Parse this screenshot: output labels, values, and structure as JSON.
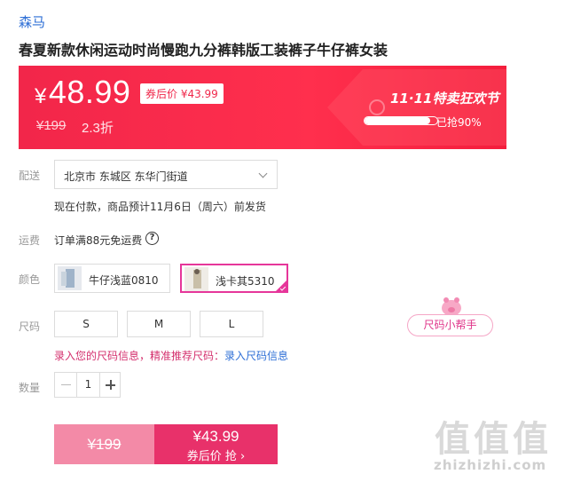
{
  "product": {
    "brand": "森马",
    "title": "春夏新款休闲运动时尚慢跑九分裤韩版工装裤子牛仔裤女装"
  },
  "price_banner": {
    "currency": "¥",
    "price": "48.99",
    "after_coupon": "券后价 ¥43.99",
    "original_price": "¥199",
    "discount": "2.3折",
    "event_title": "11·11特卖狂欢节",
    "progress_fraction": 0.9,
    "progress_text": "已抢90%",
    "colors": {
      "banner": "#f41d3c",
      "accent": "#e8316a"
    }
  },
  "delivery": {
    "label": "配送",
    "address": "北京市 东城区 东华门街道",
    "note": "现在付款，商品预计11月6日（周六）前发货"
  },
  "freight": {
    "label": "运费",
    "text": "订单满88元免运费",
    "help_icon": "?"
  },
  "color": {
    "label": "颜色",
    "options": [
      {
        "name": "牛仔浅蓝0810",
        "selected": false
      },
      {
        "name": "浅卡其5310",
        "selected": true
      }
    ]
  },
  "size": {
    "label": "尺码",
    "options": [
      "S",
      "M",
      "L"
    ],
    "helper": "尺码小帮手",
    "hint": "录入您的尺码信息，精准推荐尺码：",
    "hint_link": "录入尺码信息"
  },
  "quantity": {
    "label": "数量",
    "value": "1"
  },
  "buy": {
    "left_price": "¥199",
    "right_price": "¥43.99",
    "right_cta": "券后价 抢 ›"
  },
  "watermark": {
    "chars": "值值值",
    "url": "zhizhizhi.com"
  }
}
